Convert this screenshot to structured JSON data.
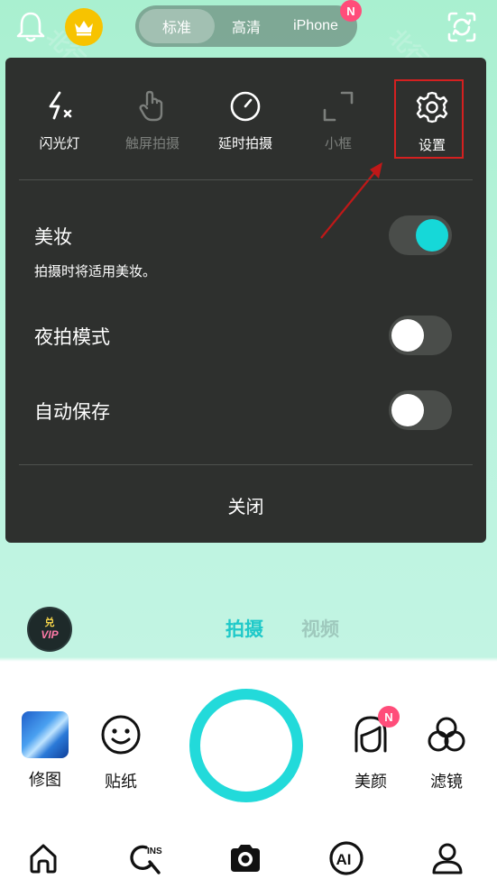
{
  "top_bar": {
    "quality_options": [
      "标准",
      "高清",
      "iPhone"
    ],
    "selected_quality": "标准",
    "quality_badge": "N",
    "icons": [
      "bell-icon",
      "crown-icon",
      "switch-camera-icon"
    ]
  },
  "panel": {
    "tools": [
      {
        "label": "闪光灯",
        "icon": "flash-off-icon",
        "enabled": true
      },
      {
        "label": "触屏拍摄",
        "icon": "touch-shot-icon",
        "enabled": false
      },
      {
        "label": "延时拍摄",
        "icon": "timer-icon",
        "enabled": true
      },
      {
        "label": "小框",
        "icon": "small-frame-icon",
        "enabled": false
      },
      {
        "label": "设置",
        "icon": "settings-gear-icon",
        "enabled": true
      }
    ],
    "settings": [
      {
        "title": "美妆",
        "subtitle": "拍摄时将适用美妆。",
        "on": true
      },
      {
        "title": "夜拍模式",
        "subtitle": "",
        "on": false
      },
      {
        "title": "自动保存",
        "subtitle": "",
        "on": false
      }
    ],
    "close_label": "关闭"
  },
  "modes": {
    "vip_top": "兑",
    "vip_bottom": "VIP",
    "items": [
      {
        "label": "拍摄",
        "active": true
      },
      {
        "label": "视频",
        "active": false
      }
    ]
  },
  "controls": {
    "left": [
      {
        "label": "修图",
        "icon": "edit-photo-thumbnail"
      },
      {
        "label": "贴纸",
        "icon": "smiley-sticker-icon"
      }
    ],
    "right": [
      {
        "label": "美颜",
        "icon": "beauty-face-icon",
        "badge": "N"
      },
      {
        "label": "滤镜",
        "icon": "filter-circles-icon"
      }
    ]
  },
  "bottom_nav": [
    "home-icon",
    "ins-search-icon",
    "camera-icon",
    "ai-icon",
    "profile-icon"
  ],
  "watermark_text": "北行软件库",
  "colors": {
    "accent": "#22dada",
    "panel_bg": "#2e302e",
    "highlight": "#d42020",
    "badge": "#ff4d7a",
    "crown": "#f7c300"
  }
}
